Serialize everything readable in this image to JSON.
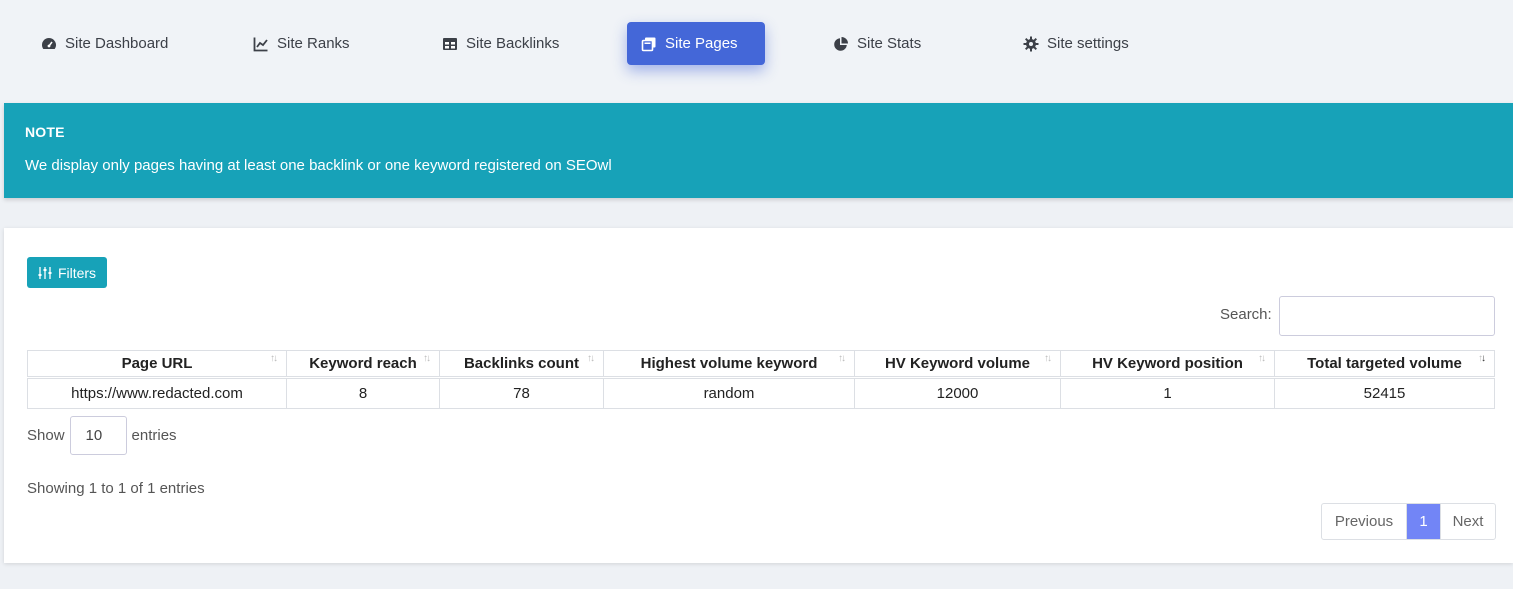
{
  "nav": {
    "items": [
      {
        "label": "Site Dashboard",
        "icon": "gauge-icon"
      },
      {
        "label": "Site Ranks",
        "icon": "line-chart-icon"
      },
      {
        "label": "Site Backlinks",
        "icon": "table-icon"
      },
      {
        "label": "Site Pages",
        "icon": "copy-pages-icon",
        "active": true
      },
      {
        "label": "Site Stats",
        "icon": "pie-chart-icon"
      },
      {
        "label": "Site settings",
        "icon": "gear-icon"
      }
    ]
  },
  "note": {
    "title": "NOTE",
    "text": "We display only pages having at least one backlink or one keyword registered on SEOwl"
  },
  "filters_label": "Filters",
  "search": {
    "label": "Search:",
    "value": ""
  },
  "table": {
    "columns": [
      "Page URL",
      "Keyword reach",
      "Backlinks count",
      "Highest volume keyword",
      "HV Keyword volume",
      "HV Keyword position",
      "Total targeted volume"
    ],
    "rows": [
      [
        "https://www.redacted.com",
        "8",
        "78",
        "random",
        "12000",
        "1",
        "52415"
      ]
    ]
  },
  "length": {
    "show": "Show",
    "value": "10",
    "entries": "entries"
  },
  "info": "Showing 1 to 1 of 1 entries",
  "pagination": {
    "previous": "Previous",
    "current": "1",
    "next": "Next"
  },
  "colors": {
    "accent": "#4467d8",
    "note_bg": "#17a2b8",
    "page_active": "#7285f6"
  }
}
